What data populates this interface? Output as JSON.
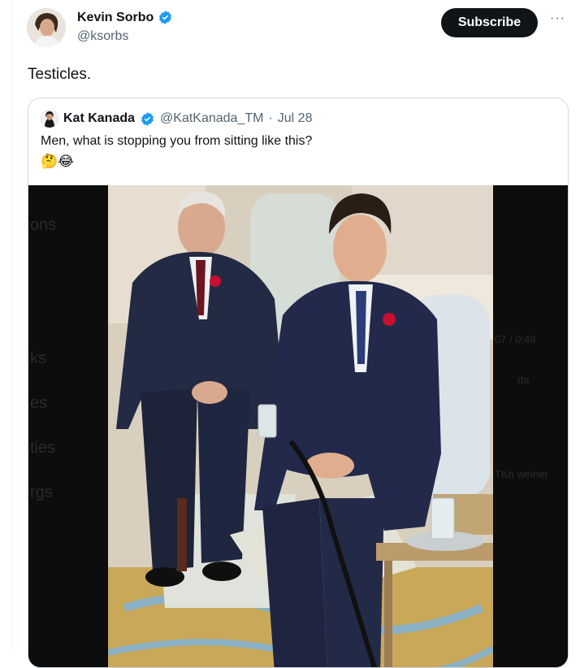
{
  "author": {
    "name": "Kevin Sorbo",
    "handle": "@ksorbs",
    "avatar_icon": "profile-photo",
    "verified": true
  },
  "actions": {
    "subscribe_label": "Subscribe",
    "more_label": "···"
  },
  "tweet": {
    "text": "Testicles."
  },
  "quoted": {
    "name": "Kat Kanada",
    "handle": "@KatKanada_TM",
    "separator": "·",
    "date": "Jul 28",
    "text": "Men, what is stopping you from sitting like this?",
    "emojis": "🤔😂"
  },
  "media_background_fragments": {
    "left": [
      "ons",
      "ks",
      "es",
      "ties",
      "rgs"
    ],
    "right": [
      "07 / 0:48",
      "da",
      "TKn weiner"
    ]
  },
  "colors": {
    "verified_blue": "#1d9bf0",
    "text_primary": "#0f1419",
    "text_secondary": "#536471",
    "poppy_red": "#c8102e"
  }
}
